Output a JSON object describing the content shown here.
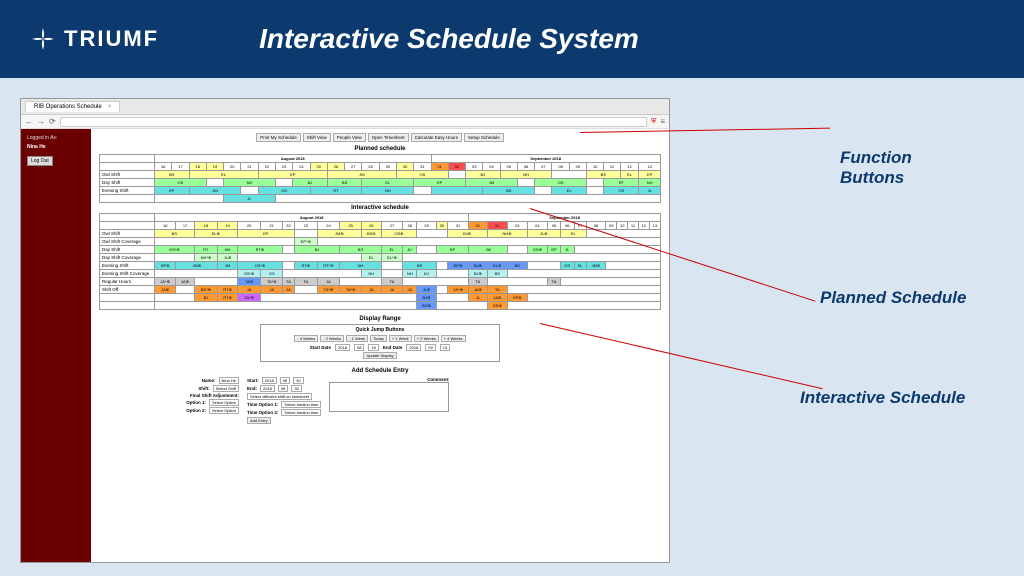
{
  "header": {
    "brand": "TRIUMF",
    "title": "Interactive Schedule System"
  },
  "browser": {
    "tab_title": "RIB Operations Schedule"
  },
  "sidebar": {
    "logged_in_label": "Logged in As:",
    "user": "Nina He",
    "logout": "Log Out"
  },
  "fn_buttons": [
    "Print My Schedule",
    "Shift View",
    "People View",
    "Open Timesheet",
    "Calculate Easy Hours",
    "Setup Schedule"
  ],
  "sections": {
    "planned": "Planned schedule",
    "interactive": "Interactive schedule",
    "display_range": "Display Range",
    "quick_jump": "Quick Jump Buttons",
    "add_entry": "Add Schedule Entry"
  },
  "months": {
    "left": "August 2018",
    "right": "September 2018"
  },
  "dates": [
    "16",
    "17",
    "18",
    "19",
    "20",
    "21",
    "22",
    "23",
    "24",
    "25",
    "26",
    "27",
    "28",
    "29",
    "30",
    "31",
    "01",
    "02",
    "03",
    "04",
    "05",
    "06",
    "07",
    "08",
    "09",
    "10",
    "11",
    "12",
    "13"
  ],
  "planned_rows": [
    {
      "label": "Owl Shift",
      "cells": [
        {
          "t": "BS",
          "c": "y",
          "s": 2
        },
        {
          "t": "EL",
          "c": "y",
          "s": 4
        },
        {
          "t": "EP",
          "c": "y",
          "s": 4
        },
        {
          "t": "JM",
          "c": "y",
          "s": 4
        },
        {
          "t": "OS",
          "c": "y",
          "s": 3
        },
        {
          "t": "",
          "c": "w",
          "s": 1
        },
        {
          "t": "BJ",
          "c": "y",
          "s": 2
        },
        {
          "t": "NH",
          "c": "y",
          "s": 3
        },
        {
          "t": "",
          "c": "w",
          "s": 2
        },
        {
          "t": "BS",
          "c": "y",
          "s": 2
        },
        {
          "t": "EL",
          "c": "y",
          "s": 1
        },
        {
          "t": "EP",
          "c": "y",
          "s": 1
        }
      ]
    },
    {
      "label": "Day Shift",
      "cells": [
        {
          "t": "OS",
          "c": "g",
          "s": 3
        },
        {
          "t": "",
          "c": "w",
          "s": 1
        },
        {
          "t": "NH",
          "c": "g",
          "s": 3
        },
        {
          "t": "",
          "c": "w",
          "s": 1
        },
        {
          "t": "BJ",
          "c": "g",
          "s": 2
        },
        {
          "t": "BS",
          "c": "g",
          "s": 2
        },
        {
          "t": "EL",
          "c": "g",
          "s": 3
        },
        {
          "t": "EP",
          "c": "g",
          "s": 3
        },
        {
          "t": "JM",
          "c": "g",
          "s": 3
        },
        {
          "t": "",
          "c": "w",
          "s": 1
        },
        {
          "t": "OS",
          "c": "g",
          "s": 3
        },
        {
          "t": "",
          "c": "w",
          "s": 1
        },
        {
          "t": "RT",
          "c": "g",
          "s": 2
        },
        {
          "t": "NH",
          "c": "g",
          "s": 1
        }
      ]
    },
    {
      "label": "Evening Shift",
      "cells": [
        {
          "t": "EP",
          "c": "c",
          "s": 2
        },
        {
          "t": "JM",
          "c": "c",
          "s": 3
        },
        {
          "t": "",
          "c": "w",
          "s": 1
        },
        {
          "t": "OS",
          "c": "c",
          "s": 3
        },
        {
          "t": "RT",
          "c": "c",
          "s": 3
        },
        {
          "t": "NH",
          "c": "c",
          "s": 3
        },
        {
          "t": "",
          "c": "w",
          "s": 1
        },
        {
          "t": "",
          "c": "c",
          "s": 3
        },
        {
          "t": "BS",
          "c": "c",
          "s": 3
        },
        {
          "t": "",
          "c": "w",
          "s": 1
        },
        {
          "t": "EL",
          "c": "c",
          "s": 2
        },
        {
          "t": "",
          "c": "w",
          "s": 1
        },
        {
          "t": "OS",
          "c": "c",
          "s": 2
        },
        {
          "t": "JL",
          "c": "c",
          "s": 1
        }
      ]
    },
    {
      "label": "",
      "cells": [
        {
          "t": "",
          "c": "w",
          "s": 4
        },
        {
          "t": "JL",
          "c": "c",
          "s": 3
        },
        {
          "t": "",
          "c": "w",
          "s": 22
        }
      ]
    }
  ],
  "interactive_rows": [
    {
      "label": "Owl Shift",
      "cells": [
        {
          "t": "BS",
          "c": "y",
          "s": 2
        },
        {
          "t": "EL⊕",
          "c": "y",
          "s": 2
        },
        {
          "t": "EP",
          "c": "y",
          "s": 3
        },
        {
          "t": "",
          "c": "w",
          "s": 1
        },
        {
          "t": "JM⊕",
          "c": "y",
          "s": 2
        },
        {
          "t": "BS⊕",
          "c": "y",
          "s": 1
        },
        {
          "t": "OS⊕",
          "c": "y",
          "s": 2
        },
        {
          "t": "",
          "c": "w",
          "s": 2
        },
        {
          "t": "BJ⊕",
          "c": "y",
          "s": 2
        },
        {
          "t": "NH⊕",
          "c": "y",
          "s": 2
        },
        {
          "t": "JL⊕",
          "c": "y",
          "s": 2
        },
        {
          "t": "EL",
          "c": "y",
          "s": 2
        },
        {
          "t": "",
          "c": "w",
          "s": 6
        }
      ]
    },
    {
      "label": "Owl Shift Coverage",
      "cells": [
        {
          "t": "",
          "c": "w",
          "s": 7
        },
        {
          "t": "EP*⊕",
          "c": "lg",
          "s": 1
        },
        {
          "t": "",
          "c": "w",
          "s": 21
        }
      ]
    },
    {
      "label": "Day Shift",
      "cells": [
        {
          "t": "OS*⊕",
          "c": "g",
          "s": 2
        },
        {
          "t": "RT",
          "c": "g",
          "s": 1
        },
        {
          "t": "NH",
          "c": "g",
          "s": 1
        },
        {
          "t": "RT⊕",
          "c": "g",
          "s": 2
        },
        {
          "t": "",
          "c": "w",
          "s": 1
        },
        {
          "t": "BJ",
          "c": "g",
          "s": 2
        },
        {
          "t": "BS",
          "c": "g",
          "s": 2
        },
        {
          "t": "EL",
          "c": "g",
          "s": 1
        },
        {
          "t": "JL*",
          "c": "g",
          "s": 1
        },
        {
          "t": "",
          "c": "w",
          "s": 1
        },
        {
          "t": "EP",
          "c": "g",
          "s": 2
        },
        {
          "t": "JM",
          "c": "g",
          "s": 2
        },
        {
          "t": "",
          "c": "w",
          "s": 1
        },
        {
          "t": "OS⊕",
          "c": "g",
          "s": 1
        },
        {
          "t": "EP",
          "c": "g",
          "s": 1
        },
        {
          "t": "JL",
          "c": "g",
          "s": 1
        },
        {
          "t": "",
          "c": "w",
          "s": 7
        }
      ]
    },
    {
      "label": "Day Shift Coverage",
      "cells": [
        {
          "t": "",
          "c": "w",
          "s": 2
        },
        {
          "t": "NH*⊕",
          "c": "lg",
          "s": 1
        },
        {
          "t": "JL⊕",
          "c": "lg",
          "s": 1
        },
        {
          "t": "",
          "c": "w",
          "s": 6
        },
        {
          "t": "EL",
          "c": "lg",
          "s": 1
        },
        {
          "t": "EL*⊕",
          "c": "lg",
          "s": 1
        },
        {
          "t": "",
          "c": "w",
          "s": 17
        }
      ]
    },
    {
      "label": "Evening Shift",
      "cells": [
        {
          "t": "EP⊕",
          "c": "c",
          "s": 1
        },
        {
          "t": "JM⊕",
          "c": "c",
          "s": 2
        },
        {
          "t": "JM",
          "c": "c",
          "s": 1
        },
        {
          "t": "OS*⊕",
          "c": "c",
          "s": 2
        },
        {
          "t": "",
          "c": "w",
          "s": 1
        },
        {
          "t": "RT⊕",
          "c": "c",
          "s": 1
        },
        {
          "t": "RT*⊕",
          "c": "c",
          "s": 1
        },
        {
          "t": "NH",
          "c": "c",
          "s": 2
        },
        {
          "t": "",
          "c": "w",
          "s": 1
        },
        {
          "t": "BS",
          "c": "c",
          "s": 2
        },
        {
          "t": "",
          "c": "w",
          "s": 1
        },
        {
          "t": "EP⊕",
          "c": "b",
          "s": 1
        },
        {
          "t": "BJ⊕",
          "c": "b",
          "s": 1
        },
        {
          "t": "EL⊕",
          "c": "b",
          "s": 1
        },
        {
          "t": "BS",
          "c": "b",
          "s": 1
        },
        {
          "t": "",
          "c": "w",
          "s": 2
        },
        {
          "t": "OS",
          "c": "c",
          "s": 1
        },
        {
          "t": "EL",
          "c": "c",
          "s": 1
        },
        {
          "t": "JM⊕",
          "c": "c",
          "s": 1
        },
        {
          "t": "",
          "c": "w",
          "s": 5
        }
      ]
    },
    {
      "label": "Evening Shift Coverage",
      "cells": [
        {
          "t": "",
          "c": "w",
          "s": 4
        },
        {
          "t": "OS*⊕",
          "c": "lc",
          "s": 1
        },
        {
          "t": "OS",
          "c": "lc",
          "s": 1
        },
        {
          "t": "",
          "c": "w",
          "s": 4
        },
        {
          "t": "NH",
          "c": "lc",
          "s": 1
        },
        {
          "t": "",
          "c": "w",
          "s": 1
        },
        {
          "t": "NH",
          "c": "lc",
          "s": 1
        },
        {
          "t": "BJ",
          "c": "lc",
          "s": 1
        },
        {
          "t": "",
          "c": "w",
          "s": 2
        },
        {
          "t": "BJ⊕",
          "c": "lc",
          "s": 1
        },
        {
          "t": "BS",
          "c": "lc",
          "s": 1
        },
        {
          "t": "",
          "c": "w",
          "s": 11
        }
      ]
    },
    {
      "label": "Regular Hours",
      "cells": [
        {
          "t": "JA*⊕",
          "c": "gr",
          "s": 1
        },
        {
          "t": "JA⊕",
          "c": "gr",
          "s": 1
        },
        {
          "t": "",
          "c": "w",
          "s": 2
        },
        {
          "t": "TA⊕",
          "c": "b",
          "s": 1
        },
        {
          "t": "TA*⊕",
          "c": "gr",
          "s": 1
        },
        {
          "t": "TA",
          "c": "gr",
          "s": 1
        },
        {
          "t": "TA",
          "c": "gr",
          "s": 1
        },
        {
          "t": "JA",
          "c": "gr",
          "s": 1
        },
        {
          "t": "",
          "c": "w",
          "s": 2
        },
        {
          "t": "TA",
          "c": "gr",
          "s": 1
        },
        {
          "t": "",
          "c": "w",
          "s": 4
        },
        {
          "t": "TA",
          "c": "gr",
          "s": 1
        },
        {
          "t": "",
          "c": "w",
          "s": 3
        },
        {
          "t": "TA",
          "c": "gr",
          "s": 1
        },
        {
          "t": "",
          "c": "w",
          "s": 8
        }
      ]
    },
    {
      "label": "Shift Off",
      "cells": [
        {
          "t": "JA⊕",
          "c": "o",
          "s": 1
        },
        {
          "t": "",
          "c": "w",
          "s": 1
        },
        {
          "t": "BS*⊕",
          "c": "o",
          "s": 1
        },
        {
          "t": "RT⊕",
          "c": "o",
          "s": 1
        },
        {
          "t": "JA",
          "c": "o",
          "s": 1
        },
        {
          "t": "JA",
          "c": "o",
          "s": 1
        },
        {
          "t": "JA",
          "c": "o",
          "s": 1
        },
        {
          "t": "",
          "c": "w",
          "s": 1
        },
        {
          "t": "TA*⊕",
          "c": "o",
          "s": 1
        },
        {
          "t": "TA*⊕",
          "c": "o",
          "s": 1
        },
        {
          "t": "JA",
          "c": "o",
          "s": 1
        },
        {
          "t": "JA",
          "c": "o",
          "s": 1
        },
        {
          "t": "JA",
          "c": "o",
          "s": 1
        },
        {
          "t": "JL⊕",
          "c": "b",
          "s": 1
        },
        {
          "t": "",
          "c": "w",
          "s": 1
        },
        {
          "t": "JA*⊕",
          "c": "o",
          "s": 1
        },
        {
          "t": "JA⊕",
          "c": "o",
          "s": 1
        },
        {
          "t": "TA",
          "c": "o",
          "s": 1
        },
        {
          "t": "",
          "c": "w",
          "s": 11
        }
      ]
    },
    {
      "label": "",
      "cells": [
        {
          "t": "",
          "c": "w",
          "s": 2
        },
        {
          "t": "BJ",
          "c": "o",
          "s": 1
        },
        {
          "t": "RT⊕",
          "c": "o",
          "s": 1
        },
        {
          "t": "TA*⊕",
          "c": "p",
          "s": 1
        },
        {
          "t": "",
          "c": "w",
          "s": 8
        },
        {
          "t": "BJ⊕",
          "c": "b",
          "s": 1
        },
        {
          "t": "",
          "c": "w",
          "s": 2
        },
        {
          "t": "JL",
          "c": "o",
          "s": 1
        },
        {
          "t": "JA⊕",
          "c": "o",
          "s": 1
        },
        {
          "t": "EP⊕",
          "c": "o",
          "s": 1
        },
        {
          "t": "",
          "c": "w",
          "s": 10
        }
      ]
    },
    {
      "label": "",
      "cells": [
        {
          "t": "",
          "c": "w",
          "s": 13
        },
        {
          "t": "BS⊕",
          "c": "b",
          "s": 1
        },
        {
          "t": "",
          "c": "w",
          "s": 3
        },
        {
          "t": "OS⊕",
          "c": "o",
          "s": 1
        },
        {
          "t": "",
          "c": "w",
          "s": 11
        }
      ]
    }
  ],
  "quick_jump": [
    "- 4 Weeks",
    "- 2 Weeks",
    "- 1 Week",
    "Today",
    "+ 1 Week",
    "+ 2 Weeks",
    "+ 4 Weeks"
  ],
  "date_range": {
    "start_label": "Start Date",
    "end_label": "End Date",
    "y1": "2018",
    "m1": "08",
    "d1": "16",
    "y2": "2018",
    "m2": "09",
    "d2": "13",
    "update": "Update Display"
  },
  "add_entry": {
    "name_label": "Name:",
    "name_val": "Nina He",
    "shift_label": "Shift:",
    "shift_val": "Select Shift",
    "fsa_label": "Final Shift Adjustment:",
    "fsa_val": "Select different shift on timesheet",
    "opt1_label": "Option 1:",
    "opt1_val": "Select Option",
    "opt2_label": "Option 2:",
    "opt2_val": "Select Option",
    "start_label": "Start:",
    "end_label": "End:",
    "y": "2018",
    "m": "08",
    "d": "30",
    "topt1_label": "Time Option 1:",
    "topt2_label": "Time Option 2:",
    "topt_val": "Select fraction time",
    "comment_label": "Comment:",
    "submit": "Add Entry"
  },
  "annotations": {
    "fn": "Function Buttons",
    "planned": "Planned Schedule",
    "inter": "Interactive Schedule"
  }
}
